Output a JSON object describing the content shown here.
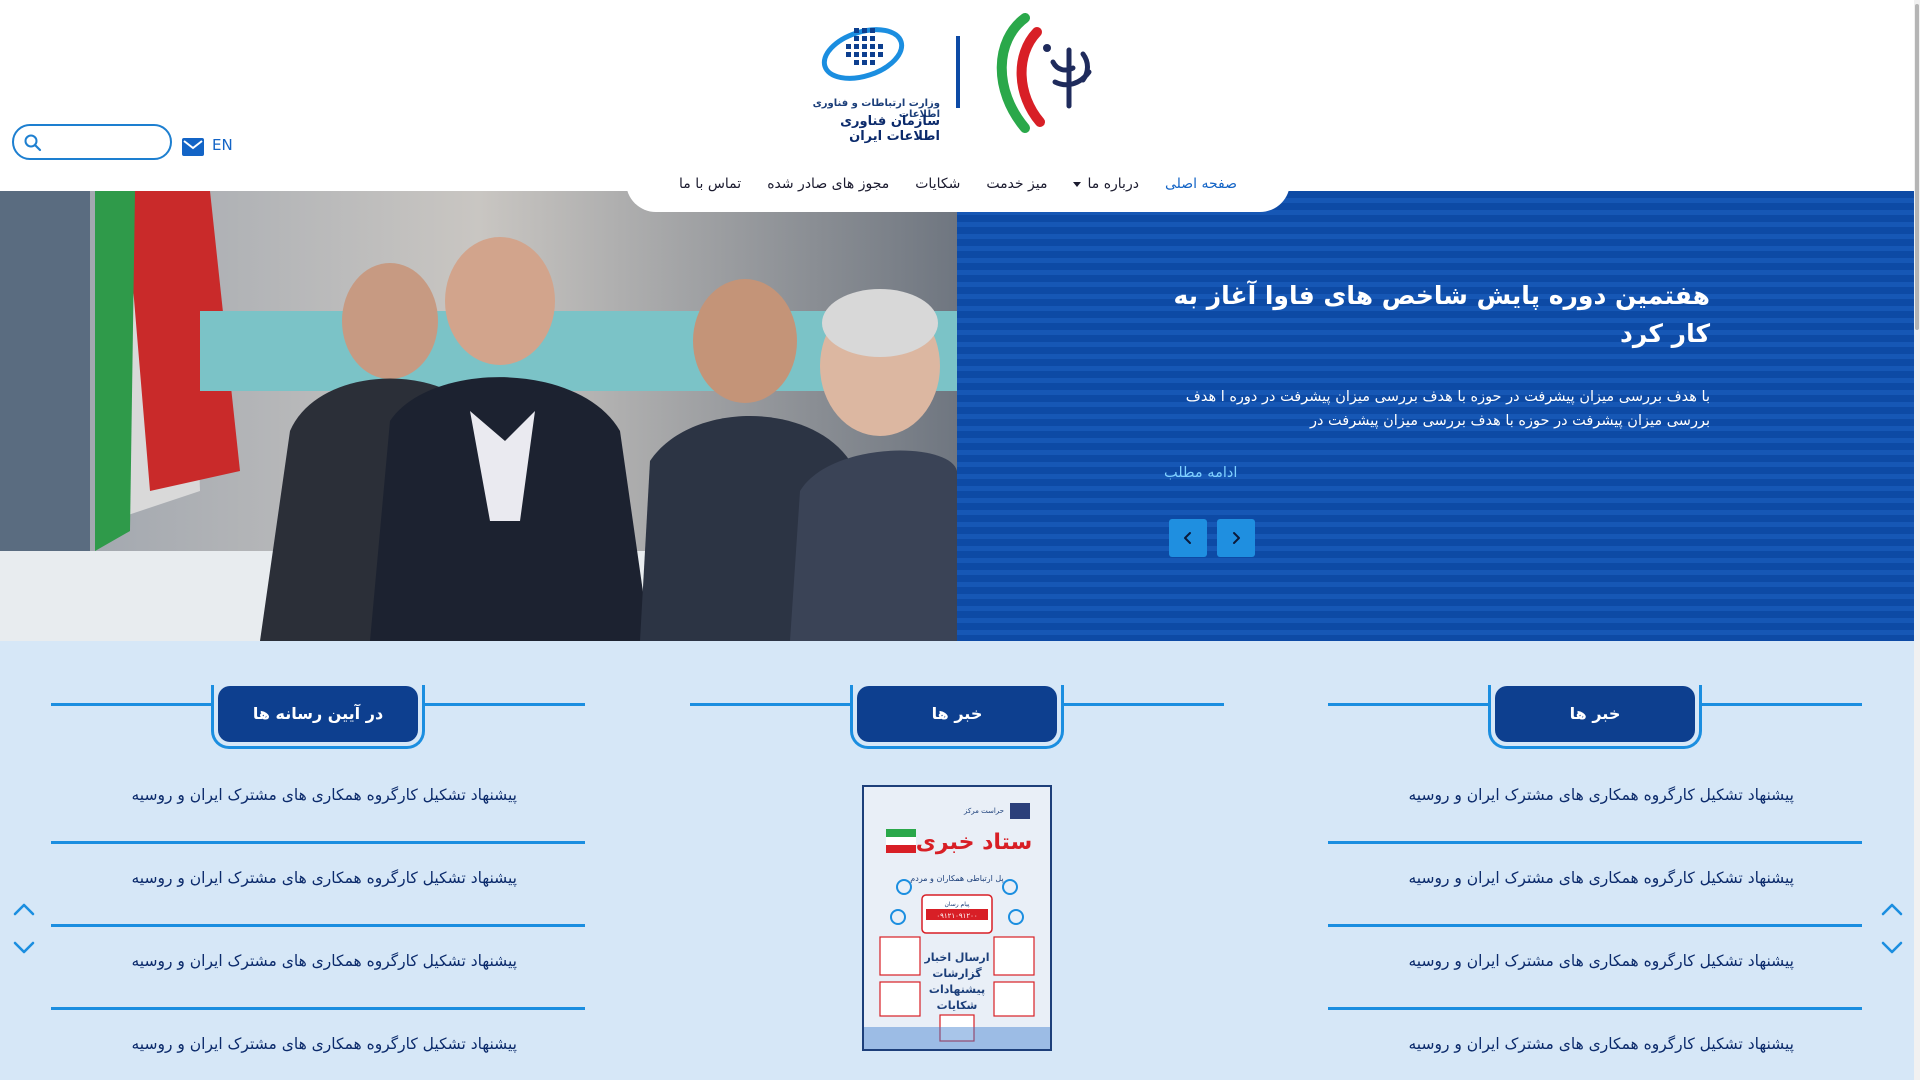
{
  "header": {
    "org_line1": "وزارت ارتباطات و فناوری اطلاعات",
    "org_line2": "سازمان فناوری اطلاعات ایران",
    "lang": "EN",
    "search": {
      "placeholder": ""
    }
  },
  "nav": {
    "items": [
      {
        "label": "صفحه اصلی",
        "active": true
      },
      {
        "label": "درباره ما",
        "dropdown": true
      },
      {
        "label": "میز خدمت"
      },
      {
        "label": "شکایات"
      },
      {
        "label": "مجوز های صادر شده"
      },
      {
        "label": "تماس با ما"
      }
    ]
  },
  "hero": {
    "title": "هفتمین دوره پایش شاخص های فاوا آغاز به کار کرد",
    "description": "با هدف بررسی میزان پیشرفت در حوزه با هدف بررسی میزان پیشرفت در دوره ا هدف بررسی میزان پیشرفت در حوزه با هدف بررسی میزان پیشرفت در",
    "more_label": "ادامه مطلب"
  },
  "columns": {
    "media": {
      "title": "در آیین رسانه ها",
      "items": [
        "پیشنهاد تشکیل کارگروه همکاری های مشترک ایران و روسیه",
        "پیشنهاد تشکیل کارگروه همکاری های مشترک ایران و روسیه",
        "پیشنهاد تشکیل کارگروه همکاری های مشترک ایران و روسیه",
        "پیشنهاد تشکیل کارگروه همکاری های مشترک ایران و روسیه"
      ]
    },
    "featured": {
      "title": "خبر ها",
      "poster": {
        "top_text": "حراست مرکز",
        "main": "ستاد خبری",
        "sub": "پل ارتباطی همکاران و مردم",
        "phone_label": "پیام رسان",
        "phone": "۰۹۱۲۱۰۹۱۲۰۰",
        "lines": [
          "ارسال اخبار",
          "گزارشات",
          "پیشنهادات",
          "شکایات"
        ]
      }
    },
    "news": {
      "title": "خبر ها",
      "items": [
        "پیشنهاد تشکیل کارگروه همکاری های مشترک ایران و روسیه",
        "پیشنهاد تشکیل کارگروه همکاری های مشترک ایران و روسیه",
        "پیشنهاد تشکیل کارگروه همکاری های مشترک ایران و روسیه",
        "پیشنهاد تشکیل کارگروه همکاری های مشترک ایران و روسیه"
      ]
    }
  },
  "colors": {
    "primary": "#0d4aa5",
    "accent": "#1b8ee0",
    "tab": "#0d3f8f",
    "content_bg": "#d6e7f7",
    "link": "#1364c6"
  },
  "icons": [
    "search-icon",
    "mail-icon",
    "chevron-left-icon",
    "chevron-right-icon",
    "chevron-up-icon",
    "chevron-down-icon",
    "caret-down-icon"
  ]
}
